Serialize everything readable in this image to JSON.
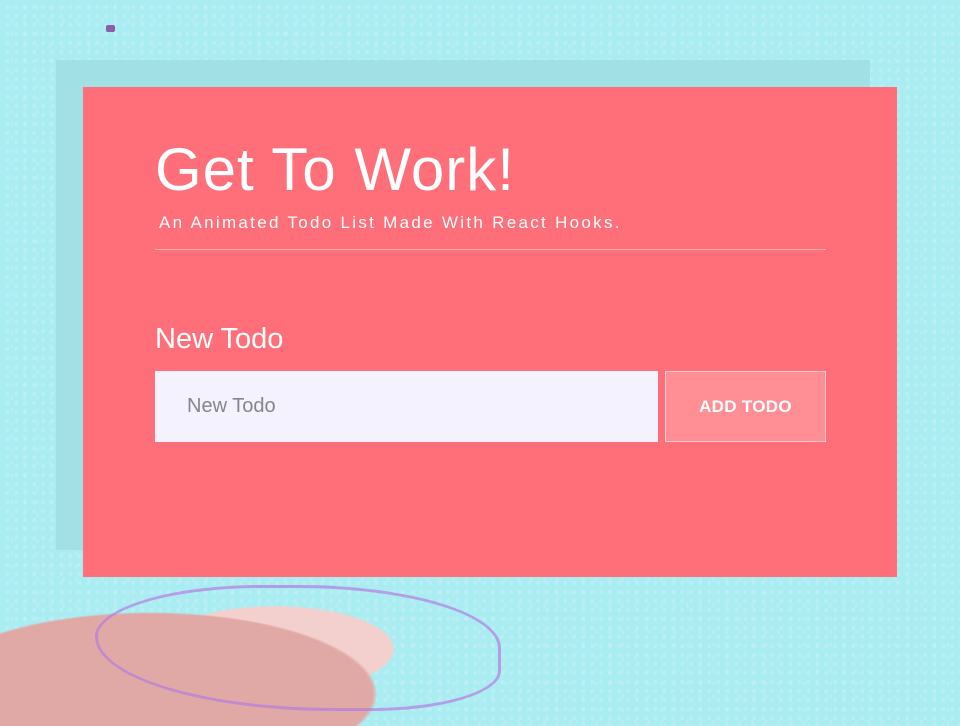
{
  "header": {
    "title": "Get To Work!",
    "subtitle": "An Animated Todo List Made With React Hooks."
  },
  "form": {
    "label": "New Todo",
    "input": {
      "value": "",
      "placeholder": "New Todo"
    },
    "add_button_label": "ADD TODO"
  },
  "colors": {
    "background": "#a9ecf1",
    "card": "#fe6f79",
    "button": "#ff8e95",
    "input_bg": "#f4f2fe"
  }
}
